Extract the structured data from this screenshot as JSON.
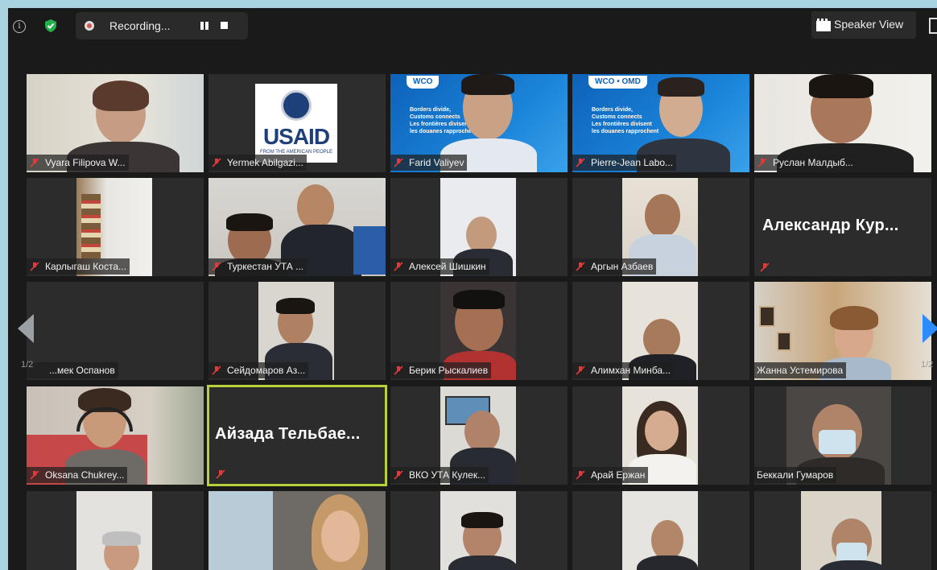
{
  "topbar": {
    "recording_label": "Recording...",
    "speaker_view_label": "Speaker View"
  },
  "paging": {
    "left": "1/2",
    "right": "1/2"
  },
  "participants": [
    {
      "name": "Vyara Filipova W...",
      "muted": true
    },
    {
      "name": "Yermek Abilgazi...",
      "muted": true
    },
    {
      "name": "Farid Valiyev",
      "muted": true
    },
    {
      "name": "Pierre-Jean Labo...",
      "muted": true
    },
    {
      "name": "Руслан Малдыб...",
      "muted": true
    },
    {
      "name": "Карлыгаш Коста...",
      "muted": true
    },
    {
      "name": "Туркестан УТА ...",
      "muted": true
    },
    {
      "name": "Алексей Шишкин",
      "muted": true
    },
    {
      "name": "Аргын Азбаев",
      "muted": true
    },
    {
      "name": "Александр Кур...",
      "muted": true
    },
    {
      "name": "...мек Оспанов",
      "muted": false
    },
    {
      "name": "Сейдомаров Аз...",
      "muted": true
    },
    {
      "name": "Берик Рыскалиев",
      "muted": true
    },
    {
      "name": "Алимхан Минба...",
      "muted": true
    },
    {
      "name": "Жанна Устемирова",
      "muted": false
    },
    {
      "name": "Oksana Chukrey...",
      "muted": true
    },
    {
      "name": "Айзада Тельбае...",
      "muted": true
    },
    {
      "name": "ВКО УТА Кулек...",
      "muted": true
    },
    {
      "name": "Арай Ержан",
      "muted": true
    },
    {
      "name": "Беккали Гумаров",
      "muted": false
    }
  ],
  "usaid": {
    "text": "USAID",
    "subtext": "FROM THE AMERICAN PEOPLE"
  },
  "wco": {
    "logo": "WCO",
    "logo2": "WCO • OMD",
    "tagline": "Borders divide,\nCustoms connects\nLes frontières divisent\nles douanes rapprochent"
  },
  "colors": {
    "active_border": "#b5d23a",
    "mute_red": "#e03a3a",
    "nav_left": "#9aa0a6",
    "nav_right": "#2d8cff"
  }
}
